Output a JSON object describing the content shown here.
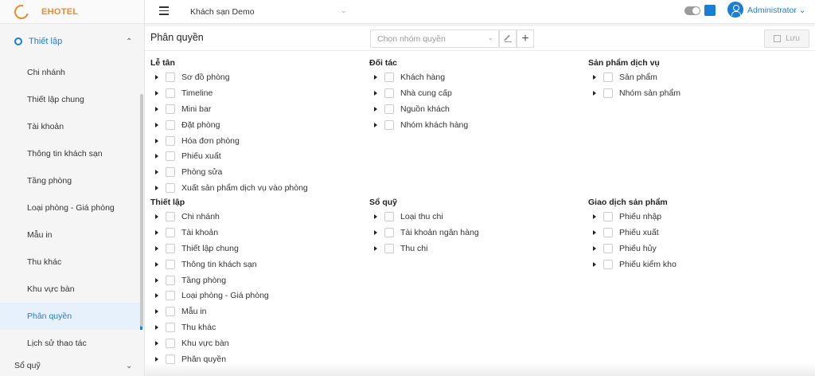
{
  "app": {
    "logo_text": "EHOTEL"
  },
  "sidebar": {
    "group_label": "Thiết lập",
    "items": [
      {
        "label": "Chi nhánh"
      },
      {
        "label": "Thiết lập chung"
      },
      {
        "label": "Tài khoản"
      },
      {
        "label": "Thông tin khách sạn"
      },
      {
        "label": "Tầng phòng"
      },
      {
        "label": "Loại phòng - Giá phòng"
      },
      {
        "label": "Mẫu in"
      },
      {
        "label": "Thu khác"
      },
      {
        "label": "Khu vực bàn"
      },
      {
        "label": "Phân quyền",
        "active": true
      },
      {
        "label": "Lịch sử thao tác"
      }
    ],
    "bottom_group_label": "Sổ quỹ"
  },
  "topbar": {
    "hotel": "Khách sạn Demo",
    "user": "Administrator",
    "theme_color": "#1a7fd4"
  },
  "page": {
    "title": "Phân quyền",
    "group_select_placeholder": "Chọn nhóm quyền",
    "save_label": "Lưu"
  },
  "sections": [
    {
      "title": "Lễ tân",
      "items": [
        "Sơ đồ phòng",
        "Timeline",
        "Mini bar",
        "Đặt phòng",
        "Hóa đơn phòng",
        "Phiếu xuất",
        "Phòng sửa",
        "Xuất sản phẩm dịch vụ vào phòng"
      ]
    },
    {
      "title": "Đối tác",
      "items": [
        "Khách hàng",
        "Nhà cung cấp",
        "Nguồn khách",
        "Nhóm khách hàng"
      ]
    },
    {
      "title": "Sản phẩm dịch vụ",
      "items": [
        "Sản phẩm",
        "Nhóm sản phẩm"
      ]
    },
    {
      "title": "Thiết lập",
      "items": [
        "Chi nhánh",
        "Tài khoản",
        "Thiết lập chung",
        "Thông tin khách sạn",
        "Tầng phòng",
        "Loại phòng - Giá phòng",
        "Mẫu in",
        "Thu khác",
        "Khu vực bàn",
        "Phân quyền"
      ]
    },
    {
      "title": "Sổ quỹ",
      "items": [
        "Loại thu chi",
        "Tài khoản ngân hàng",
        "Thu chi"
      ]
    },
    {
      "title": "Giao dịch sản phẩm",
      "items": [
        "Phiếu nhập",
        "Phiếu xuất",
        "Phiếu hủy",
        "Phiếu kiểm kho"
      ]
    }
  ]
}
